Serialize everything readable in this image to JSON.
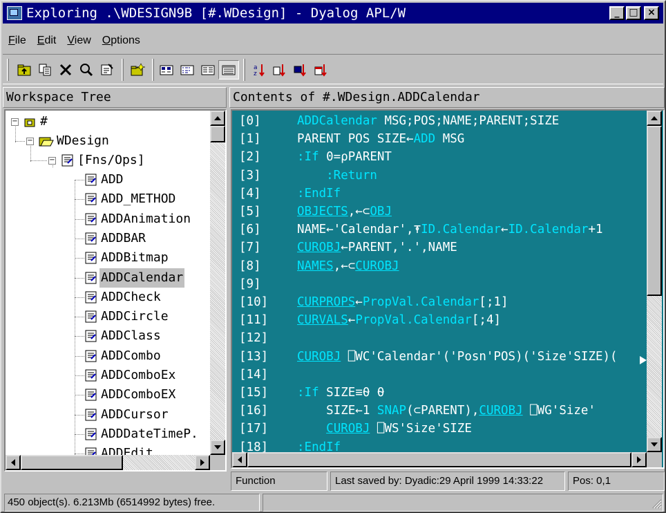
{
  "window": {
    "title": "Exploring .\\WDESIGN9B [#.WDesign] - Dyalog APL/W",
    "minimize_label": "_",
    "maximize_label": "□",
    "close_label": "×"
  },
  "menu": {
    "file": "File",
    "edit": "Edit",
    "view": "View",
    "options": "Options"
  },
  "toolbar": {
    "buttons": [
      "up-folder-icon",
      "copy-icon",
      "delete-icon",
      "find-icon",
      "properties-icon",
      "new-folder-icon",
      "large-icons-icon",
      "small-icons-icon",
      "list-icon",
      "details-icon",
      "sort-by-name-icon",
      "sort-by-type-icon",
      "sort-by-size-icon",
      "sort-by-date-icon"
    ]
  },
  "tree_panel": {
    "header": "Workspace Tree",
    "root": "#",
    "namespace": "WDesign",
    "group": "[Fns/Ops]",
    "items": [
      "ADD",
      "ADD_METHOD",
      "ADDAnimation",
      "ADDBAR",
      "ADDBitmap",
      "ADDCalendar",
      "ADDCheck",
      "ADDCircle",
      "ADDClass",
      "ADDCombo",
      "ADDComboEx",
      "ADDComboEX",
      "ADDCursor",
      "ADDDateTimeP.",
      "ADDEdit"
    ],
    "selected": "ADDCalendar",
    "expander_collapse": "−"
  },
  "editor": {
    "header": "Contents of #.WDesign.ADDCalendar",
    "lines": [
      {
        "n": "[0]",
        "parts": [
          {
            "t": "ADDCalendar",
            "c": "kw"
          },
          {
            "t": " MSG;POS;NAME;PARENT;SIZE",
            "c": ""
          }
        ]
      },
      {
        "n": "[1]",
        "parts": [
          {
            "t": "PARENT POS SIZE←",
            "c": ""
          },
          {
            "t": "ADD",
            "c": "kw"
          },
          {
            "t": " MSG",
            "c": ""
          }
        ]
      },
      {
        "n": "[2]",
        "parts": [
          {
            "t": ":If",
            "c": "kw"
          },
          {
            "t": " 0=⍴PARENT",
            "c": ""
          }
        ]
      },
      {
        "n": "[3]",
        "parts": [
          {
            "t": "    :Return",
            "c": "kw"
          }
        ]
      },
      {
        "n": "[4]",
        "parts": [
          {
            "t": ":EndIf",
            "c": "kw"
          }
        ]
      },
      {
        "n": "[5]",
        "parts": [
          {
            "t": "OBJECTS",
            "c": "ul"
          },
          {
            "t": ",←⊂",
            "c": ""
          },
          {
            "t": "OBJ",
            "c": "ul"
          }
        ]
      },
      {
        "n": "[6]",
        "parts": [
          {
            "t": "NAME←'Calendar',⍕",
            "c": ""
          },
          {
            "t": "ID.Calendar",
            "c": "kw"
          },
          {
            "t": "←",
            "c": ""
          },
          {
            "t": "ID.Calendar",
            "c": "kw"
          },
          {
            "t": "+1",
            "c": ""
          }
        ]
      },
      {
        "n": "[7]",
        "parts": [
          {
            "t": "CUROBJ",
            "c": "ul"
          },
          {
            "t": "←PARENT,'.',NAME",
            "c": ""
          }
        ]
      },
      {
        "n": "[8]",
        "parts": [
          {
            "t": "NAMES",
            "c": "ul"
          },
          {
            "t": ",←⊂",
            "c": ""
          },
          {
            "t": "CUROBJ",
            "c": "ul"
          }
        ]
      },
      {
        "n": "[9]",
        "parts": []
      },
      {
        "n": "[10]",
        "parts": [
          {
            "t": "CURPROPS",
            "c": "ul"
          },
          {
            "t": "←",
            "c": ""
          },
          {
            "t": "PropVal.Calendar",
            "c": "kw"
          },
          {
            "t": "[;1]",
            "c": ""
          }
        ]
      },
      {
        "n": "[11]",
        "parts": [
          {
            "t": "CURVALS",
            "c": "ul"
          },
          {
            "t": "←",
            "c": ""
          },
          {
            "t": "PropVal.Calendar",
            "c": "kw"
          },
          {
            "t": "[;4]",
            "c": ""
          }
        ]
      },
      {
        "n": "[12]",
        "parts": []
      },
      {
        "n": "[13]",
        "parts": [
          {
            "t": "CUROBJ",
            "c": "ul"
          },
          {
            "t": " ⎕WC'Calendar'('Posn'POS)('Size'SIZE)(",
            "c": ""
          }
        ]
      },
      {
        "n": "[14]",
        "parts": []
      },
      {
        "n": "[15]",
        "parts": [
          {
            "t": ":If",
            "c": "kw"
          },
          {
            "t": " SIZE≡⍬ ⍬",
            "c": ""
          }
        ]
      },
      {
        "n": "[16]",
        "parts": [
          {
            "t": "    SIZE←1 ",
            "c": ""
          },
          {
            "t": "SNAP",
            "c": "kw"
          },
          {
            "t": "(⊂PARENT),",
            "c": ""
          },
          {
            "t": "CUROBJ",
            "c": "ul"
          },
          {
            "t": " ⎕WG'Size'",
            "c": ""
          }
        ]
      },
      {
        "n": "[17]",
        "parts": [
          {
            "t": "    ",
            "c": ""
          },
          {
            "t": "CUROBJ",
            "c": "ul"
          },
          {
            "t": " ⎕WS'Size'SIZE",
            "c": ""
          }
        ]
      },
      {
        "n": "[18]",
        "parts": [
          {
            "t": ":EndIf",
            "c": "kw"
          }
        ]
      }
    ]
  },
  "editor_status": {
    "type": "Function",
    "saved": "Last saved by: Dyadic:29 April 1999 14:33:22",
    "pos": "Pos: 0,1"
  },
  "statusbar": {
    "free": "450 object(s). 6.213Mb (6514992 bytes) free."
  }
}
